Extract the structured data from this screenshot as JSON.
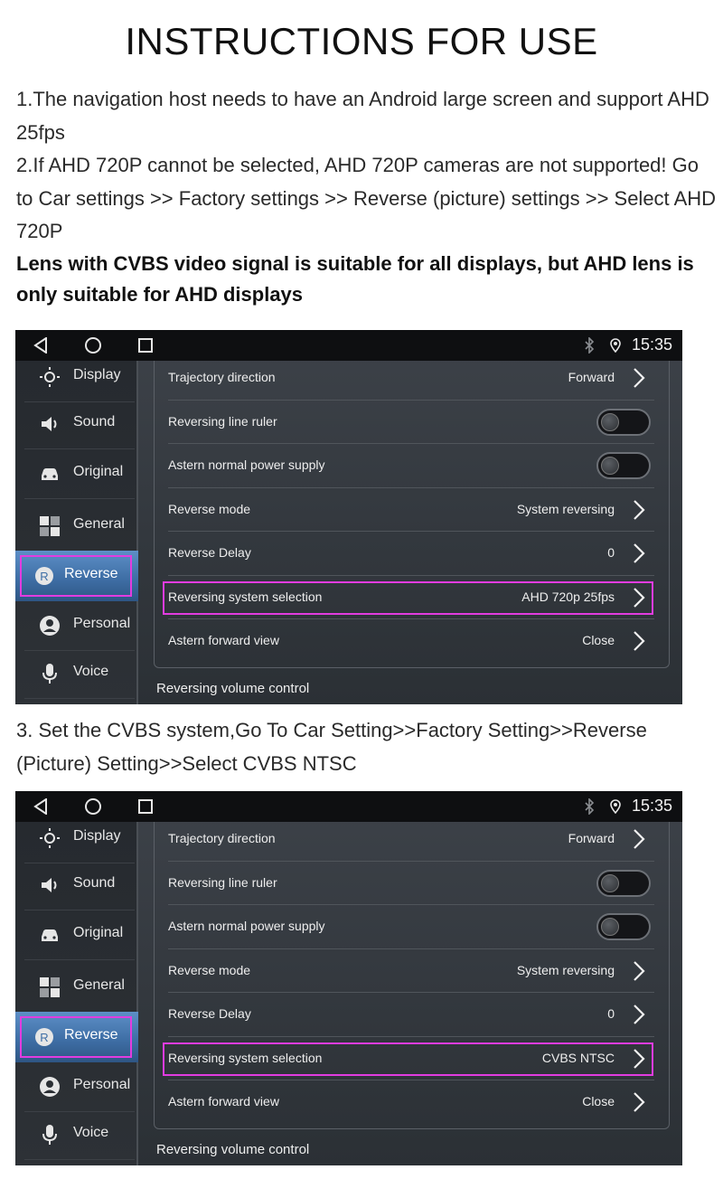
{
  "page": {
    "title": "INSTRUCTIONS FOR USE",
    "instruction_1": "1.The navigation host needs to have an Android large screen and support AHD 25fps",
    "instruction_2": "2.If AHD 720P cannot be selected, AHD 720P cameras are not supported! Go to Car settings >> Factory settings >> Reverse (picture) settings >> Select AHD 720P",
    "note": "Lens with CVBS video signal is suitable for all displays, but AHD lens is only suitable for AHD displays",
    "instruction_3": "3. Set the CVBS system,Go To Car Setting>>Factory Setting>>Reverse (Picture) Setting>>Select CVBS NTSC"
  },
  "screens": [
    {
      "status": {
        "time": "15:35"
      },
      "sidebar": [
        "Display",
        "Sound",
        "Original",
        "General",
        "Reverse",
        "Personal",
        "Voice"
      ],
      "active_item": "Reverse",
      "rows": {
        "trajectory": {
          "label": "Trajectory direction",
          "value": "Forward"
        },
        "ruler": {
          "label": "Reversing line ruler"
        },
        "power": {
          "label": "Astern normal power supply"
        },
        "mode": {
          "label": "Reverse mode",
          "value": "System reversing"
        },
        "delay": {
          "label": "Reverse Delay",
          "value": "0"
        },
        "system": {
          "label": "Reversing system selection",
          "value": "AHD 720p 25fps"
        },
        "forward_view": {
          "label": "Astern forward view",
          "value": "Close"
        }
      },
      "footer_label": "Reversing volume control"
    },
    {
      "status": {
        "time": "15:35"
      },
      "sidebar": [
        "Display",
        "Sound",
        "Original",
        "General",
        "Reverse",
        "Personal",
        "Voice"
      ],
      "active_item": "Reverse",
      "rows": {
        "trajectory": {
          "label": "Trajectory direction",
          "value": "Forward"
        },
        "ruler": {
          "label": "Reversing line ruler"
        },
        "power": {
          "label": "Astern normal power supply"
        },
        "mode": {
          "label": "Reverse mode",
          "value": "System reversing"
        },
        "delay": {
          "label": "Reverse Delay",
          "value": "0"
        },
        "system": {
          "label": "Reversing system selection",
          "value": "CVBS NTSC"
        },
        "forward_view": {
          "label": "Astern forward view",
          "value": "Close"
        }
      },
      "footer_label": "Reversing volume control"
    }
  ],
  "colors": {
    "highlight": "#e23ce0",
    "active_tab": "#4a7bb4",
    "status_bar": "#0e0f11"
  },
  "icons": [
    "back-icon",
    "home-icon",
    "recent-apps-icon",
    "bluetooth-icon",
    "location-icon",
    "brightness-icon",
    "speaker-icon",
    "car-icon",
    "grid-icon",
    "reverse-r-icon",
    "person-icon",
    "microphone-icon",
    "chevron-right-icon"
  ]
}
